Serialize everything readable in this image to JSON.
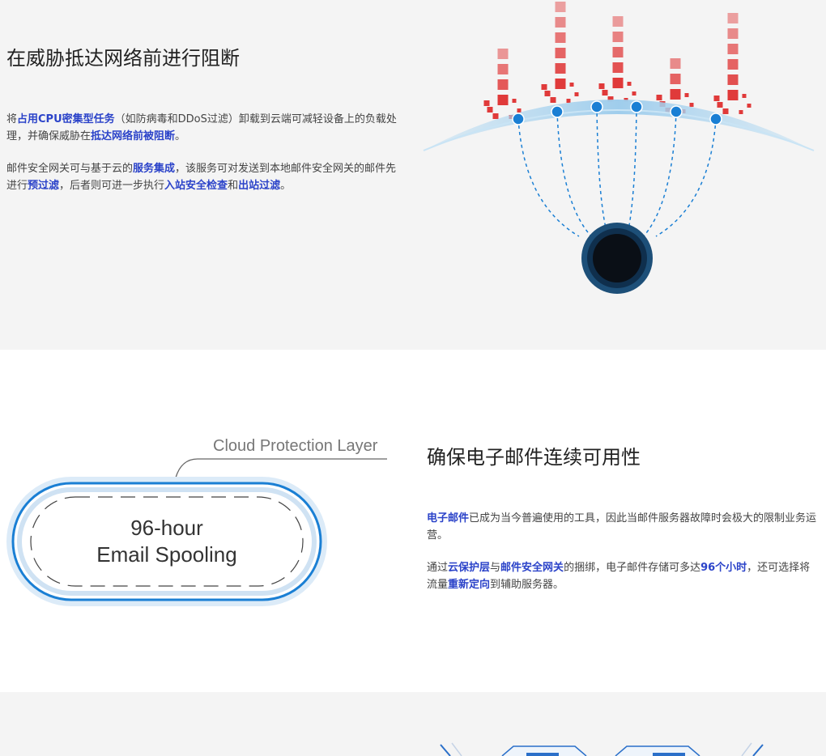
{
  "section1": {
    "title": "在威胁抵达网络前进行阻断",
    "p1": [
      {
        "t": "将",
        "hl": false
      },
      {
        "t": "占用CPU密集型任务",
        "hl": true
      },
      {
        "t": "（如防病毒和DDoS过滤）卸载到云端可减轻设备上的负载处理，并确保威胁在",
        "hl": false
      },
      {
        "t": "抵达网络前被阻断",
        "hl": true
      },
      {
        "t": "。",
        "hl": false
      }
    ],
    "p2": [
      {
        "t": "邮件安全网关可与基于云的",
        "hl": false
      },
      {
        "t": "服务集成",
        "hl": true
      },
      {
        "t": "，该服务可对发送到本地邮件安全网关的邮件先进行",
        "hl": false
      },
      {
        "t": "预过滤",
        "hl": true
      },
      {
        "t": "，后者则可进一步执行",
        "hl": false
      },
      {
        "t": "入站安全检查",
        "hl": true
      },
      {
        "t": "和",
        "hl": false
      },
      {
        "t": "出站过滤",
        "hl": true
      },
      {
        "t": "。",
        "hl": false
      }
    ]
  },
  "section2": {
    "title": "确保电子邮件连续可用性",
    "p1": [
      {
        "t": "电子邮件",
        "hl": true
      },
      {
        "t": "已成为当今普遍使用的工具，因此当邮件服务器故障时会极大的限制业务运营。",
        "hl": false
      }
    ],
    "p2": [
      {
        "t": "通过",
        "hl": false
      },
      {
        "t": "云保护层",
        "hl": true
      },
      {
        "t": "与",
        "hl": false
      },
      {
        "t": "邮件安全网关",
        "hl": true
      },
      {
        "t": "的捆绑，电子邮件存储可多达",
        "hl": false
      },
      {
        "t": "96个小时",
        "hl": true
      },
      {
        "t": "，还可选择将流量",
        "hl": false
      },
      {
        "t": "重新定向",
        "hl": true
      },
      {
        "t": "到辅助服务器。",
        "hl": false
      }
    ],
    "diagram": {
      "callout": "Cloud Protection Layer",
      "pill_line1": "96-hour",
      "pill_line2": "Email Spooling"
    }
  },
  "colors": {
    "highlight": "#2b43c9",
    "threat_red": "#e03a3a",
    "node_blue": "#1a7fd4",
    "network_navy": "#13385a",
    "band_grey": "#f4f4f4"
  }
}
